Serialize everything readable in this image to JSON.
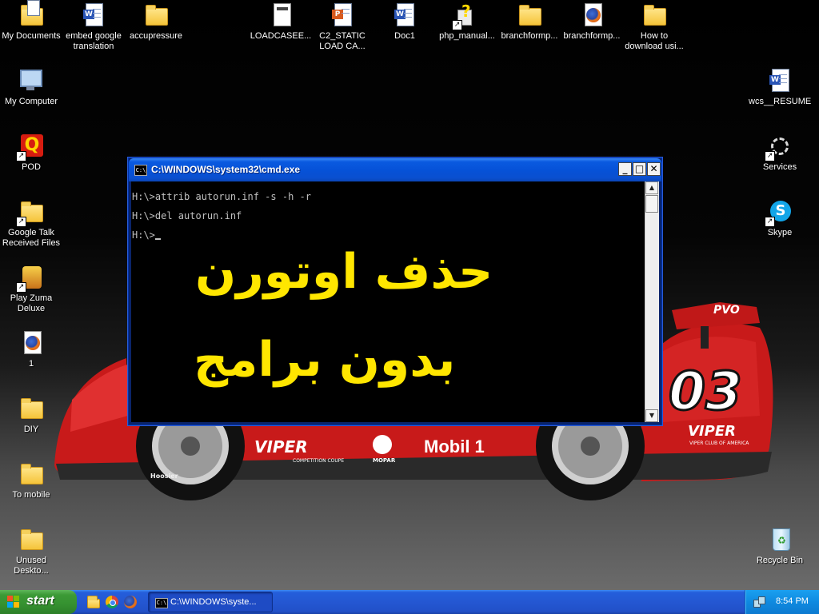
{
  "desktop": {
    "icons_left": [
      {
        "label": "My Documents",
        "icon": "my-documents-icon"
      },
      {
        "label": "My Computer",
        "icon": "my-computer-icon"
      },
      {
        "label": "POD",
        "icon": "pod-q-icon"
      },
      {
        "label": "Google Talk Received Files",
        "icon": "folder-shortcut-icon"
      },
      {
        "label": "Play Zuma Deluxe",
        "icon": "zuma-icon"
      },
      {
        "label": "1",
        "icon": "firefox-document-icon"
      },
      {
        "label": "DIY",
        "icon": "folder-icon"
      },
      {
        "label": "To mobile",
        "icon": "folder-icon"
      },
      {
        "label": "Unused Deskto...",
        "icon": "folder-icon"
      }
    ],
    "icons_top": [
      {
        "label": "embed google translation",
        "icon": "word-document-icon"
      },
      {
        "label": "accupressure",
        "icon": "folder-icon"
      },
      {
        "label": "LOADCASEE...",
        "icon": "document-icon"
      },
      {
        "label": "C2_STATIC LOAD CA...",
        "icon": "powerpoint-document-icon"
      },
      {
        "label": "Doc1",
        "icon": "word-document-icon"
      },
      {
        "label": "php_manual...",
        "icon": "help-file-icon"
      },
      {
        "label": "branchformp...",
        "icon": "folder-icon"
      },
      {
        "label": "branchformp...",
        "icon": "firefox-document-icon"
      },
      {
        "label": "How to download usi...",
        "icon": "folder-icon"
      }
    ],
    "icons_right": [
      {
        "label": "wcs__RESUME",
        "icon": "word-document-icon"
      },
      {
        "label": "Services",
        "icon": "services-gear-icon"
      },
      {
        "label": "Skype",
        "icon": "skype-icon"
      },
      {
        "label": "Recycle Bin",
        "icon": "recycle-bin-icon"
      }
    ],
    "wallpaper": {
      "car_number": "03",
      "sponsor": "Mobil 1",
      "brand": "VIPER",
      "brand_sub": "COMPETITION COUPE",
      "club": "VIPER CLUB OF AMERICA",
      "wing": "PVO",
      "mopar": "MOPAR",
      "tire": "Hoosier"
    }
  },
  "cmd_window": {
    "title": "C:\\WINDOWS\\system32\\cmd.exe",
    "icon_text": "C:\\",
    "minimize_label": "_",
    "maximize_label": "□",
    "close_label": "✕",
    "lines": [
      "H:\\>attrib autorun.inf -s -h -r",
      "H:\\>del autorun.inf",
      "H:\\>"
    ],
    "overlay_line1": "حذف اوتورن",
    "overlay_line2": "بدون برامج",
    "colors": {
      "overlay": "#ffe600",
      "console_bg": "#000000",
      "console_text": "#c0c0c0"
    }
  },
  "taskbar": {
    "start_label": "start",
    "task_label": "C:\\WINDOWS\\syste...",
    "task_icon_text": "C:\\",
    "clock": "8:54 PM",
    "quick_launch": [
      "folder-icon",
      "chrome-icon",
      "firefox-icon"
    ]
  }
}
